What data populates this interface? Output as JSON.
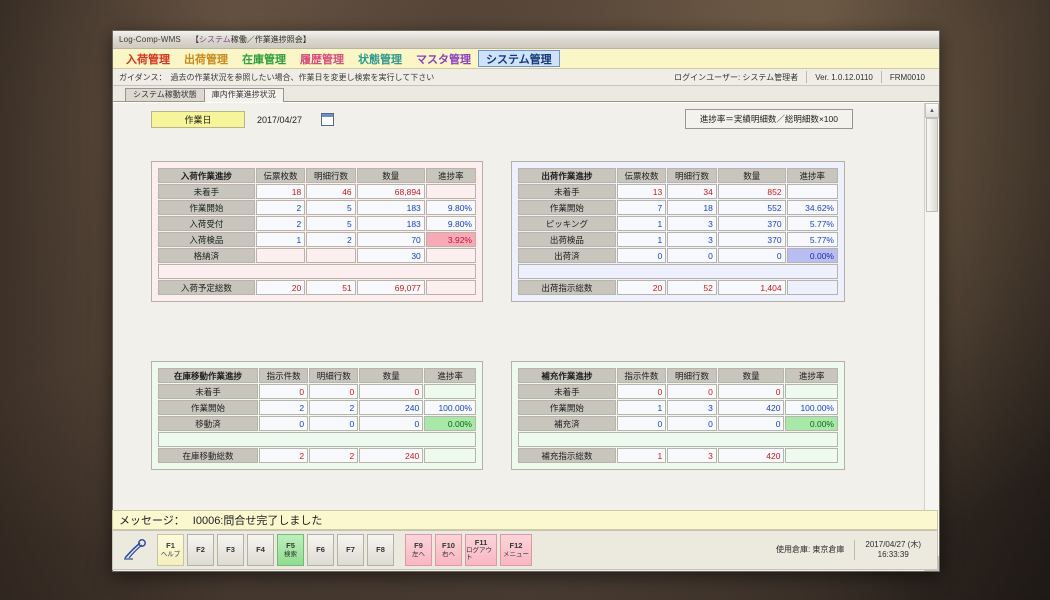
{
  "titlebar": {
    "app": "Log-Comp-WMS",
    "sub_prefix": "【",
    "sub_colored": "システム",
    "sub_rest": "稼働／作業進捗照会】"
  },
  "menu": [
    {
      "label": "入荷管理",
      "tone": "red",
      "selected": false
    },
    {
      "label": "出荷管理",
      "tone": "orange",
      "selected": false
    },
    {
      "label": "在庫管理",
      "tone": "green",
      "selected": false
    },
    {
      "label": "履歴管理",
      "tone": "pink",
      "selected": false
    },
    {
      "label": "状態管理",
      "tone": "teal",
      "selected": false
    },
    {
      "label": "マスタ管理",
      "tone": "purple",
      "selected": false
    },
    {
      "label": "システム管理",
      "tone": "sel",
      "selected": true
    }
  ],
  "guidance": {
    "label": "ガイダンス：",
    "text": "過去の作業状況を参照したい場合、作業日を変更し検索を実行して下さい",
    "login_user": "ログインユーザー: システム管理者",
    "version": "Ver. 1.0.12.0110",
    "form_id": "FRM0010"
  },
  "tabs": [
    {
      "label": "システム稼動状態",
      "active": false
    },
    {
      "label": "庫内作業進捗状況",
      "active": true
    }
  ],
  "work_date": {
    "label": "作業日",
    "value": "2017/04/27",
    "icon": "calendar-icon"
  },
  "formula": "進捗率＝実績明細数／総明細数×100",
  "tables": {
    "inbound": {
      "title": "入荷作業進捗",
      "header_color": "#f7adb8",
      "columns": [
        "伝票枚数",
        "明細行数",
        "数量",
        "進捗率"
      ],
      "rows": [
        {
          "label": "未着手",
          "values": [
            "18",
            "46",
            "68,894",
            ""
          ],
          "style": "red",
          "highlight": ""
        },
        {
          "label": "作業開始",
          "values": [
            "2",
            "5",
            "183",
            "9.80%"
          ],
          "style": "blue",
          "highlight": ""
        },
        {
          "label": "入荷受付",
          "values": [
            "2",
            "5",
            "183",
            "9.80%"
          ],
          "style": "blue",
          "highlight": ""
        },
        {
          "label": "入荷検品",
          "values": [
            "1",
            "2",
            "70",
            "3.92%"
          ],
          "style": "blue",
          "highlight": "pink"
        },
        {
          "label": "格納済",
          "values": [
            "",
            "",
            "30",
            ""
          ],
          "style": "blue",
          "highlight": ""
        }
      ],
      "total": {
        "label": "入荷予定総数",
        "values": [
          "20",
          "51",
          "69,077",
          ""
        ]
      }
    },
    "outbound": {
      "title": "出荷作業進捗",
      "header_color": "#b9bdf2",
      "columns": [
        "伝票枚数",
        "明細行数",
        "数量",
        "進捗率"
      ],
      "rows": [
        {
          "label": "未着手",
          "values": [
            "13",
            "34",
            "852",
            ""
          ],
          "style": "red",
          "highlight": ""
        },
        {
          "label": "作業開始",
          "values": [
            "7",
            "18",
            "552",
            "34.62%"
          ],
          "style": "blue",
          "highlight": ""
        },
        {
          "label": "ピッキング",
          "values": [
            "1",
            "3",
            "370",
            "5.77%"
          ],
          "style": "blue",
          "highlight": ""
        },
        {
          "label": "出荷検品",
          "values": [
            "1",
            "3",
            "370",
            "5.77%"
          ],
          "style": "blue",
          "highlight": ""
        },
        {
          "label": "出荷済",
          "values": [
            "0",
            "0",
            "0",
            "0.00%"
          ],
          "style": "blue",
          "highlight": "purple"
        }
      ],
      "total": {
        "label": "出荷指示総数",
        "values": [
          "20",
          "52",
          "1,404",
          ""
        ]
      }
    },
    "stock_move": {
      "title": "在庫移動作業進捗",
      "header_color": "#a8e8a8",
      "columns": [
        "指示件数",
        "明細行数",
        "数量",
        "進捗率"
      ],
      "rows": [
        {
          "label": "未着手",
          "values": [
            "0",
            "0",
            "0",
            ""
          ],
          "style": "red",
          "highlight": ""
        },
        {
          "label": "作業開始",
          "values": [
            "2",
            "2",
            "240",
            "100.00%"
          ],
          "style": "blue",
          "highlight": ""
        },
        {
          "label": "移動済",
          "values": [
            "0",
            "0",
            "0",
            "0.00%"
          ],
          "style": "blue",
          "highlight": "green"
        }
      ],
      "total": {
        "label": "在庫移動総数",
        "values": [
          "2",
          "2",
          "240",
          ""
        ]
      }
    },
    "replenish": {
      "title": "補充作業進捗",
      "header_color": "#a8e8a8",
      "columns": [
        "指示件数",
        "明細行数",
        "数量",
        "進捗率"
      ],
      "rows": [
        {
          "label": "未着手",
          "values": [
            "0",
            "0",
            "0",
            ""
          ],
          "style": "red",
          "highlight": ""
        },
        {
          "label": "作業開始",
          "values": [
            "1",
            "3",
            "420",
            "100.00%"
          ],
          "style": "blue",
          "highlight": ""
        },
        {
          "label": "補充済",
          "values": [
            "0",
            "0",
            "0",
            "0.00%"
          ],
          "style": "blue",
          "highlight": "green"
        }
      ],
      "total": {
        "label": "補充指示総数",
        "values": [
          "1",
          "3",
          "420",
          ""
        ]
      }
    }
  },
  "message": {
    "label": "メッセージ：",
    "text": "I0006:問合せ完了しました"
  },
  "function_keys": [
    {
      "key": "F1",
      "caption": "ヘルプ",
      "tone": "yellow"
    },
    {
      "key": "F2",
      "caption": "",
      "tone": "plain"
    },
    {
      "key": "F3",
      "caption": "",
      "tone": "plain"
    },
    {
      "key": "F4",
      "caption": "",
      "tone": "plain"
    },
    {
      "key": "F5",
      "caption": "検索",
      "tone": "green"
    },
    {
      "key": "F6",
      "caption": "",
      "tone": "plain"
    },
    {
      "key": "F7",
      "caption": "",
      "tone": "plain"
    },
    {
      "key": "F8",
      "caption": "",
      "tone": "plain"
    },
    {
      "key": "F9",
      "caption": "左へ",
      "tone": "pink"
    },
    {
      "key": "F10",
      "caption": "右へ",
      "tone": "pink"
    },
    {
      "key": "F11",
      "caption": "ログアウト",
      "tone": "pink"
    },
    {
      "key": "F12",
      "caption": "メニュー",
      "tone": "pink"
    }
  ],
  "status": {
    "warehouse": "使用倉庫: 東京倉庫",
    "datetime_date": "2017/04/27 (木)",
    "datetime_time": "16:33:39"
  }
}
